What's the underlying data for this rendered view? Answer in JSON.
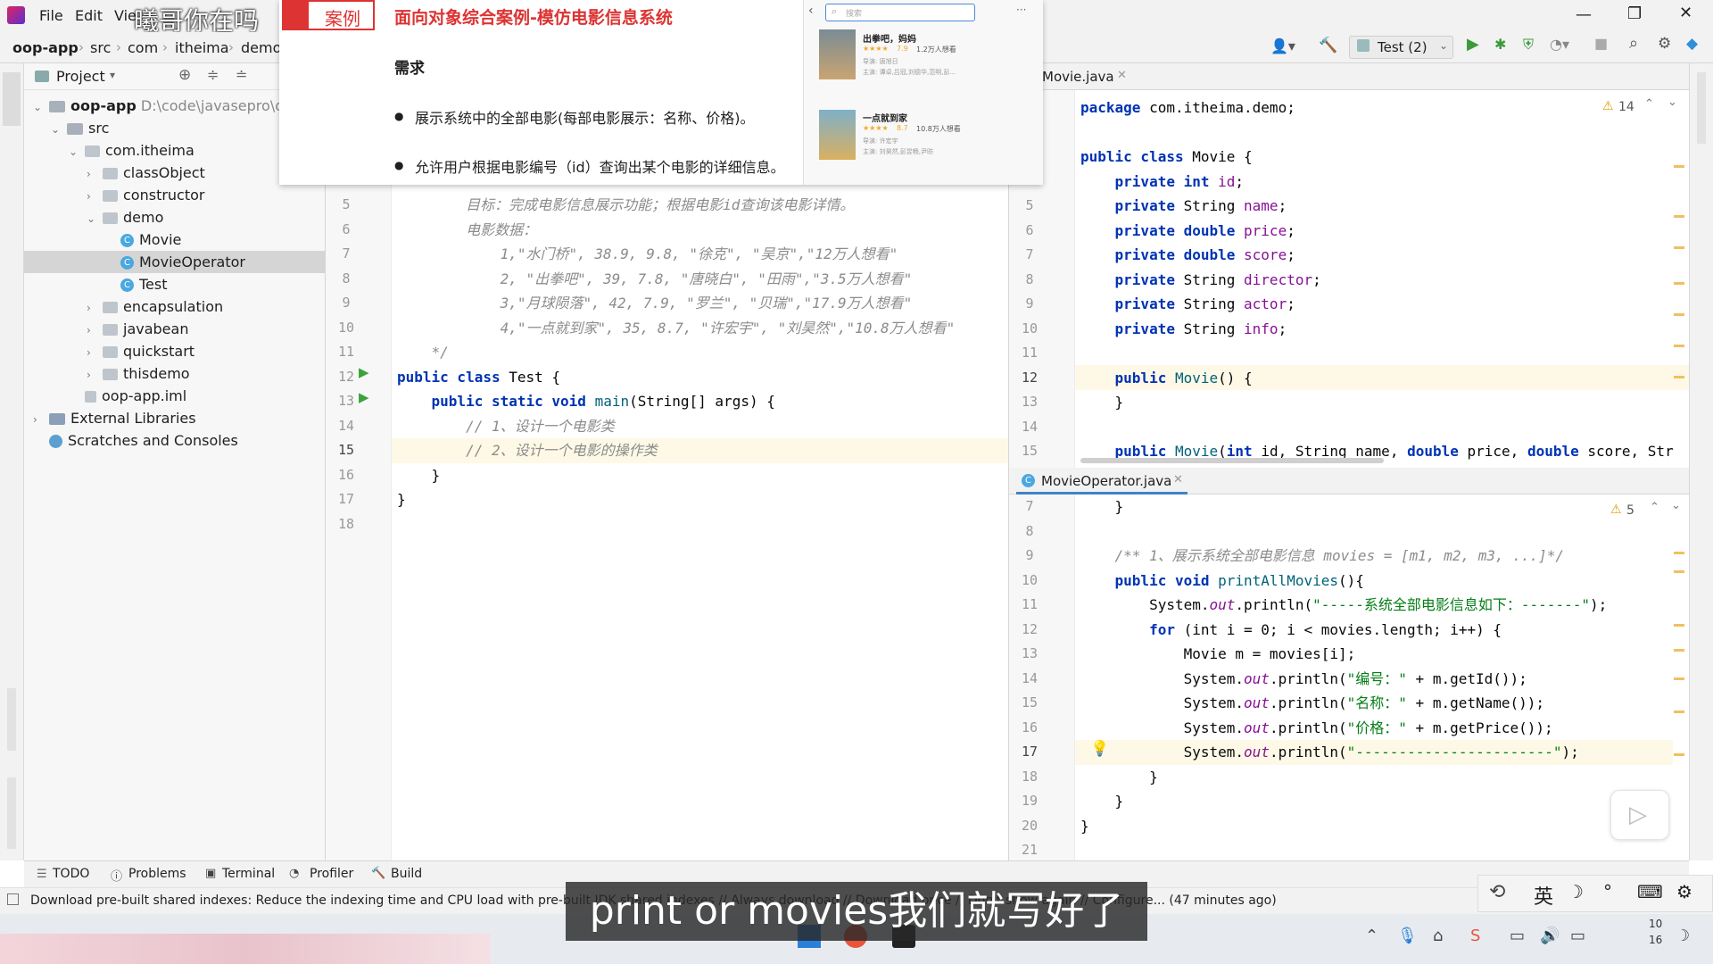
{
  "window": {
    "menu": [
      "File",
      "Edit",
      "Vie"
    ],
    "watermark": "曦哥你在吗"
  },
  "breadcrumb": [
    "oop-app",
    "src",
    "com",
    "itheima",
    "demo"
  ],
  "run_config": "Test (2)",
  "project_panel": {
    "title": "Project",
    "tree": [
      {
        "label": "oop-app",
        "extra": "D:\\code\\javasepro\\oo",
        "indent": 0,
        "type": "module",
        "arrow": "v"
      },
      {
        "label": "src",
        "indent": 1,
        "type": "folder",
        "arrow": "v"
      },
      {
        "label": "com.itheima",
        "indent": 2,
        "type": "package",
        "arrow": "v"
      },
      {
        "label": "classObject",
        "indent": 3,
        "type": "package",
        "arrow": ">"
      },
      {
        "label": "constructor",
        "indent": 3,
        "type": "package",
        "arrow": ">"
      },
      {
        "label": "demo",
        "indent": 3,
        "type": "package",
        "arrow": "v"
      },
      {
        "label": "Movie",
        "indent": 4,
        "type": "class",
        "arrow": ""
      },
      {
        "label": "MovieOperator",
        "indent": 4,
        "type": "class",
        "arrow": "",
        "selected": true
      },
      {
        "label": "Test",
        "indent": 4,
        "type": "class",
        "arrow": ""
      },
      {
        "label": "encapsulation",
        "indent": 3,
        "type": "package",
        "arrow": ">"
      },
      {
        "label": "javabean",
        "indent": 3,
        "type": "package",
        "arrow": ">"
      },
      {
        "label": "quickstart",
        "indent": 3,
        "type": "package",
        "arrow": ">"
      },
      {
        "label": "thisdemo",
        "indent": 3,
        "type": "package",
        "arrow": ">"
      },
      {
        "label": "oop-app.iml",
        "indent": 2,
        "type": "file",
        "arrow": ""
      },
      {
        "label": "External Libraries",
        "indent": 0,
        "type": "lib",
        "arrow": ">"
      },
      {
        "label": "Scratches and Consoles",
        "indent": 0,
        "type": "scratch",
        "arrow": ""
      }
    ]
  },
  "overlay": {
    "badge": "案例",
    "title": "面向对象综合案例-模仿电影信息系统",
    "section": "需求",
    "bullets": [
      "展示系统中的全部电影(每部电影展示：名称、价格)。",
      "允许用户根据电影编号（id）查询出某个电影的详细信息。"
    ],
    "search_placeholder": "搜索",
    "movies": [
      {
        "name": "出拳吧，妈妈",
        "score": "7.9",
        "wish": "1.2万人想看",
        "line1": "导演: 唐旭日",
        "line2": "主演: 谭卓,吕冠,刘德华,范明,彭..."
      },
      {
        "name": "一点就到家",
        "score": "8.7",
        "wish": "10.8万人想看",
        "line1": "导演: 许宏宇",
        "line2": "主演: 刘昊然,彭昱畅,尹昉"
      }
    ]
  },
  "editor_left": {
    "lines": [
      5,
      6,
      7,
      8,
      9,
      10,
      11,
      12,
      13,
      14,
      15,
      16,
      17,
      18
    ],
    "code": [
      "        目标：完成电影信息展示功能；根据电影id查询该电影详情。",
      "        电影数据：",
      "            1,\"水门桥\", 38.9, 9.8, \"徐克\", \"吴京\",\"12万人想看\"",
      "            2, \"出拳吧\", 39, 7.8, \"唐晓白\", \"田雨\",\"3.5万人想看\"",
      "            3,\"月球陨落\", 42, 7.9, \"罗兰\", \"贝瑞\",\"17.9万人想看\"",
      "            4,\"一点就到家\", 35, 8.7, \"许宏宇\", \"刘昊然\",\"10.8万人想看\"",
      "    */",
      "",
      "",
      "        // 1、设计一个电影类",
      "        // 2、设计一个电影的操作类",
      "    }",
      "}",
      ""
    ],
    "class_decl": {
      "kw": "public class ",
      "name": "Test {"
    },
    "main_decl": {
      "kw": "    public static void ",
      "name": "main",
      "rest": "(String[] args) {"
    }
  },
  "editor_movie": {
    "tab": "Movie.java",
    "warnings": "14",
    "lines": [
      5,
      6,
      7,
      8,
      9,
      10,
      11,
      12,
      13,
      14,
      15
    ],
    "package_line": "package com.itheima.demo;",
    "class_line": "public class Movie {",
    "fields": [
      {
        "type": "int",
        "name": "id"
      },
      {
        "type": "String",
        "name": "name"
      },
      {
        "type": "double",
        "name": "price"
      },
      {
        "type": "double",
        "name": "score"
      },
      {
        "type": "String",
        "name": "director"
      },
      {
        "type": "String",
        "name": "actor"
      },
      {
        "type": "String",
        "name": "info"
      }
    ],
    "ctor1": "Movie() {",
    "ctor2": "Movie(int id, String name, double price, double score, Str"
  },
  "editor_operator": {
    "tab": "MovieOperator.java",
    "warnings": "5",
    "lines": [
      7,
      8,
      9,
      10,
      11,
      12,
      13,
      14,
      15,
      16,
      17,
      18,
      19,
      20,
      21
    ],
    "doc": "/** 1、展示系统全部电影信息 movies = [m1, m2, m3, ...]*/",
    "print_header": "\"-----系统全部电影信息如下：-------\"",
    "for_rest": " (int i = 0; i < movies.length; i++) {",
    "movie_line": "Movie m = movies[i];",
    "labels": [
      "\"编号：\"",
      "\"名称：\"",
      "\"价格：\""
    ],
    "getters": [
      " + m.getId());",
      " + m.getName());",
      " + m.getPrice());"
    ],
    "dash": "\"-----------------------\""
  },
  "bottom_tools": [
    "TODO",
    "Problems",
    "Terminal",
    "Profiler",
    "Build"
  ],
  "status": "Download pre-built shared indexes: Reduce the indexing time and CPU load with pre-built JDK shared indexes // Always download // Download once // Don't show again // Configure... (47 minutes ago)",
  "subtitle": "print or movies我们就写好了",
  "ime": {
    "lang": "英"
  },
  "clock": {
    "line1": "10",
    "line2": "16"
  }
}
